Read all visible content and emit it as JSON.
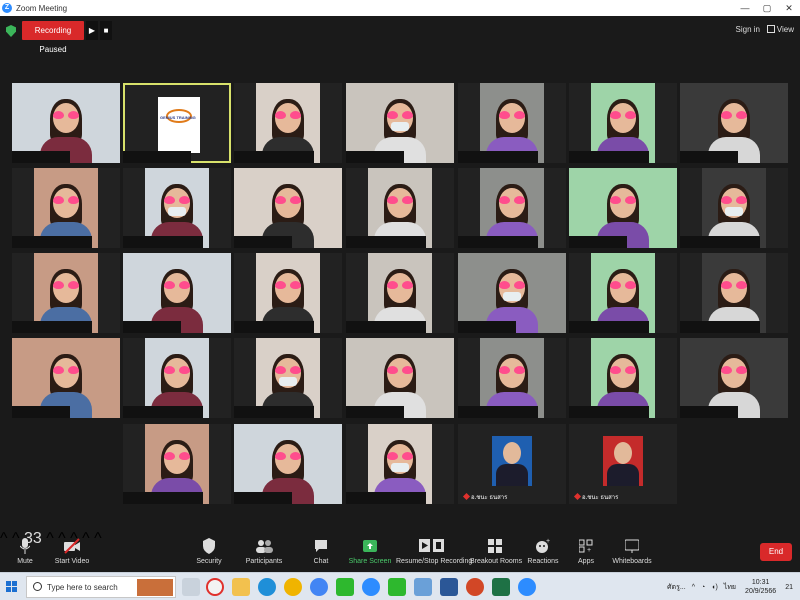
{
  "window": {
    "title": "Zoom Meeting",
    "controls": [
      "—",
      "▢",
      "✕"
    ]
  },
  "top": {
    "recording_status": "Recording Paused",
    "signin": "Sign in",
    "view": "View"
  },
  "gallery": {
    "caption_name": "อ.ชนะ ธนสาร"
  },
  "tile_logo_text": "GENIUS TRAINING",
  "toolbar": {
    "mute": "Mute",
    "start_video": "Start Video",
    "security": "Security",
    "participants": "Participants",
    "participant_count": "33",
    "chat": "Chat",
    "share_screen": "Share Screen",
    "record": "Resume/Stop Recording",
    "breakout": "Breakout Rooms",
    "reactions": "Reactions",
    "apps": "Apps",
    "whiteboards": "Whiteboards",
    "end": "End"
  },
  "taskbar": {
    "search_placeholder": "Type here to search",
    "ime": "ไทย",
    "time": "10:31",
    "date": "20/9/2566",
    "notif_count": "21",
    "weather_label": "ศัตรู..."
  }
}
